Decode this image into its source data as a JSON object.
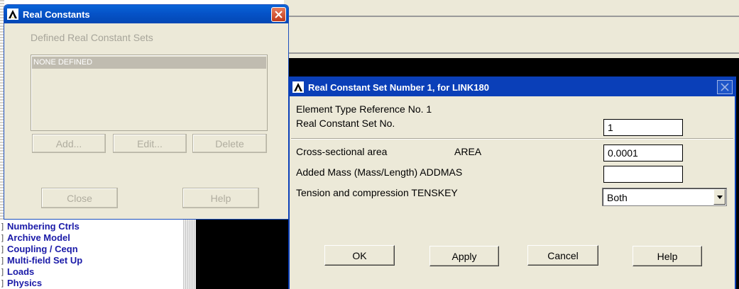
{
  "menu_tree": {
    "items": [
      {
        "label": "Numbering Ctrls"
      },
      {
        "label": "Archive Model"
      },
      {
        "label": "Coupling / Ceqn"
      },
      {
        "label": "Multi-field Set Up"
      },
      {
        "label": "Loads"
      },
      {
        "label": "Physics"
      }
    ]
  },
  "real_constants_window": {
    "title": "Real Constants",
    "heading": "Defined Real Constant Sets",
    "list_items": [
      "NONE DEFINED"
    ],
    "buttons": {
      "add": "Add...",
      "edit": "Edit...",
      "delete": "Delete",
      "close": "Close",
      "help": "Help"
    }
  },
  "set_dialog": {
    "title": "Real Constant Set Number 1, for LINK180",
    "element_type_ref": "Element Type Reference No. 1",
    "set_no_label": "Real Constant Set No.",
    "set_no_value": "1",
    "area_label": "Cross-sectional area",
    "area_key": "AREA",
    "area_value": "0.0001",
    "mass_label": "Added Mass (Mass/Length)  ADDMAS",
    "mass_value": "",
    "tension_label": "Tension and compression  TENSKEY",
    "tension_value": "Both",
    "buttons": {
      "ok": "OK",
      "apply": "Apply",
      "cancel": "Cancel",
      "help": "Help"
    }
  },
  "icons": {
    "app_logo": "ansys-logo-icon",
    "close": "close-icon",
    "dropdown": "chevron-down-icon"
  },
  "colors": {
    "title_blue": "#0a3fb8",
    "window_face": "#ece9d8",
    "menu_text": "#1a1aa8"
  }
}
